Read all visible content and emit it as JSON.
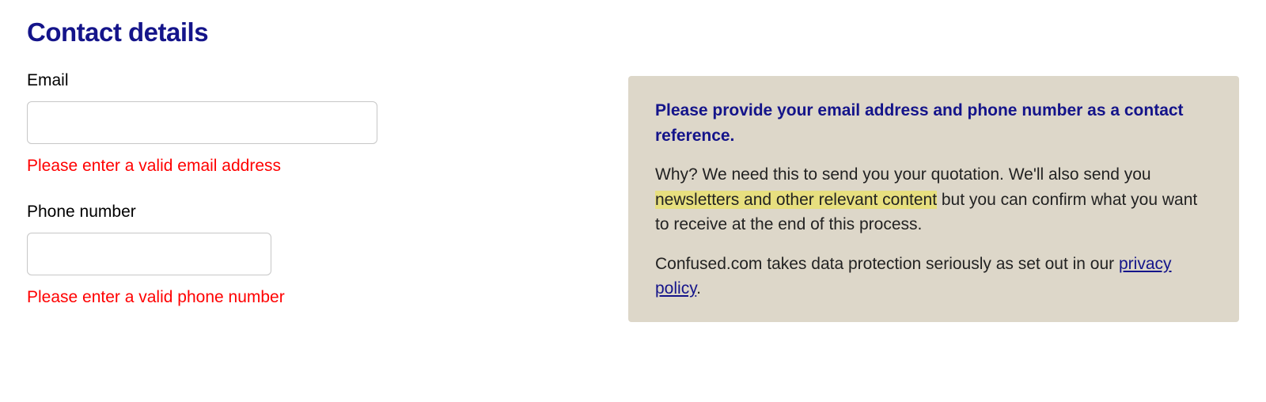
{
  "heading": "Contact details",
  "form": {
    "email": {
      "label": "Email",
      "value": "",
      "error": "Please enter a valid email address"
    },
    "phone": {
      "label": "Phone number",
      "value": "",
      "error": "Please enter a valid phone number"
    }
  },
  "info": {
    "title": "Please provide your email address and phone number as a contact reference.",
    "para1_a": "Why? We need this to send you your quotation. We'll also send you ",
    "para1_highlight": "newsletters and other relevant content",
    "para1_b": " but you can confirm what you want to receive at the end of this process.",
    "para2_a": "Confused.com takes data protection seriously as set out in our ",
    "privacy_link_text": "privacy policy",
    "para2_b": "."
  }
}
